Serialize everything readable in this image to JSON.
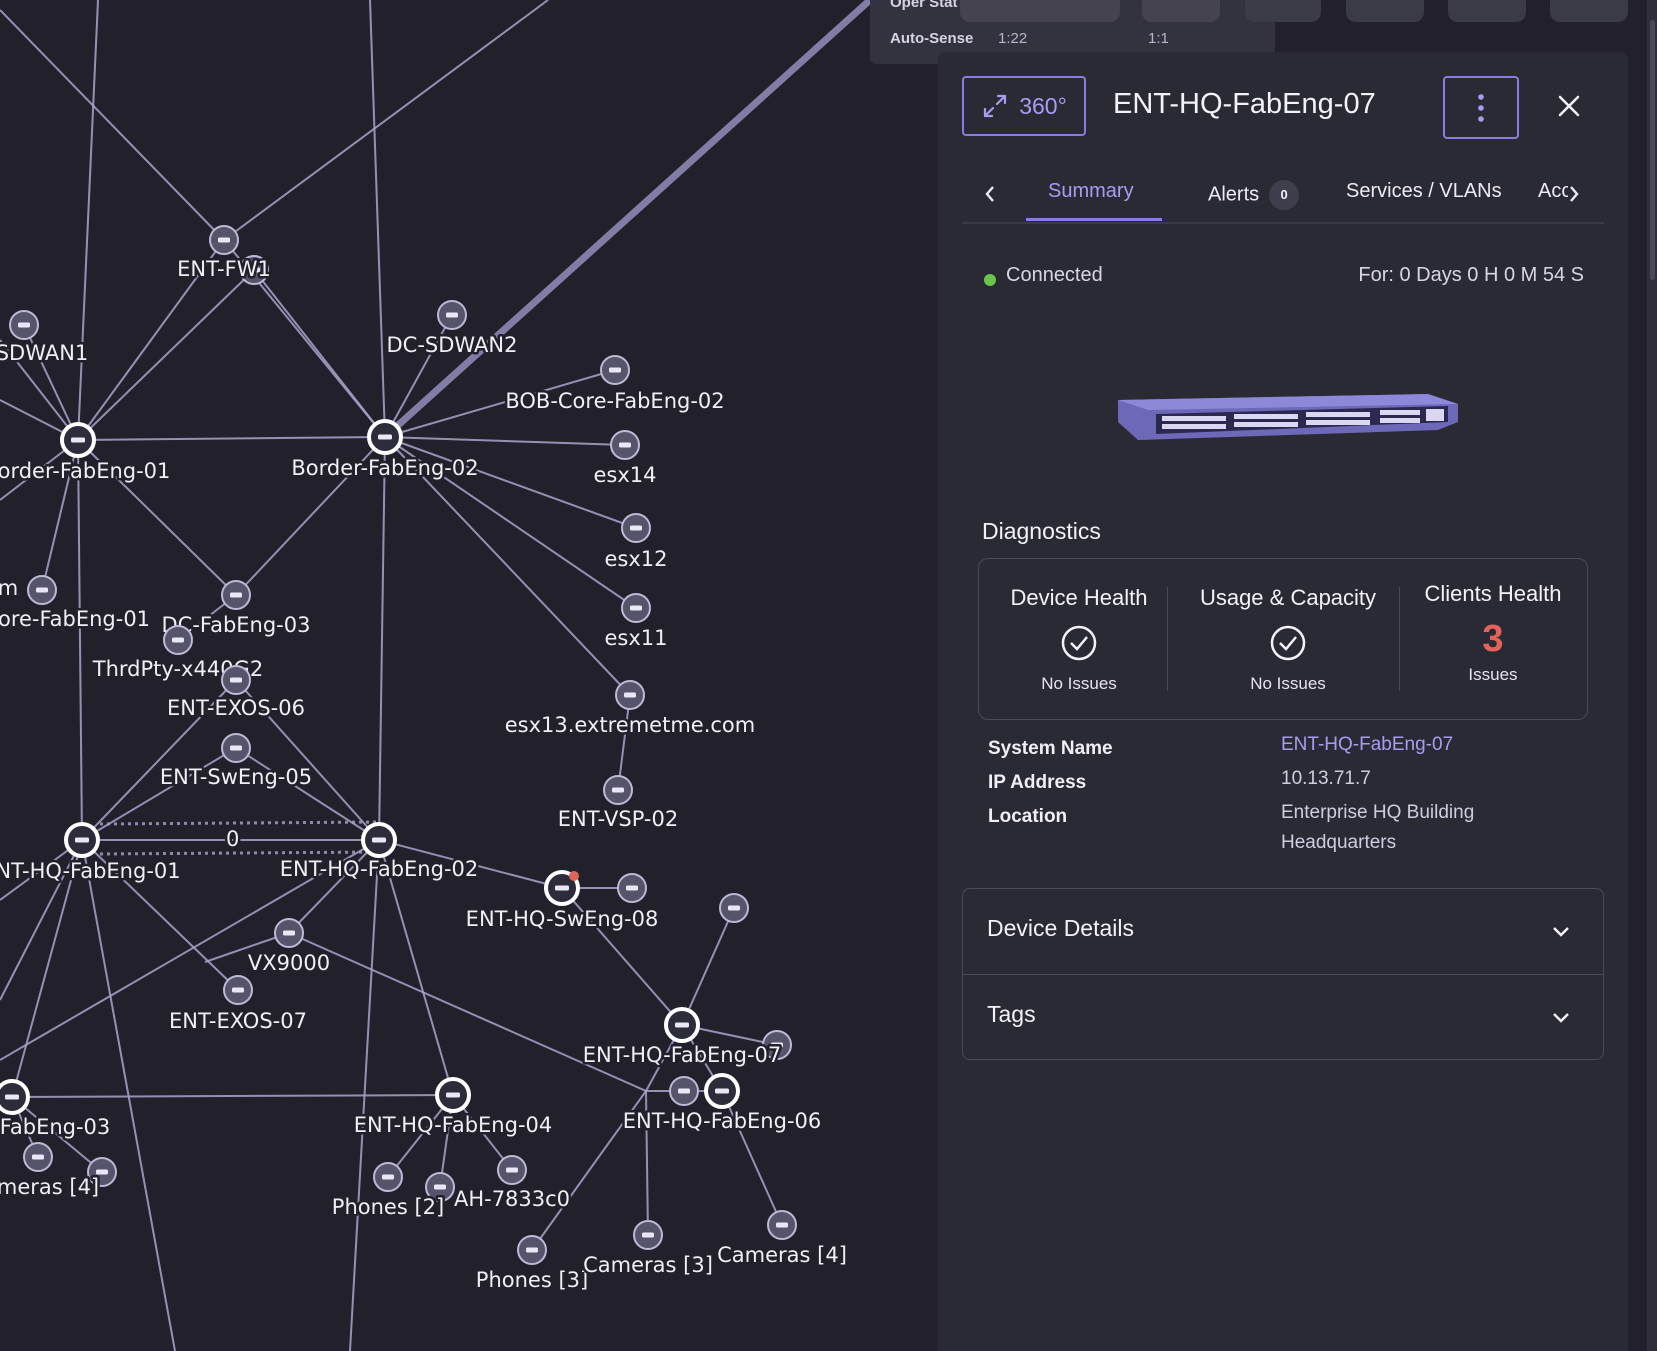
{
  "oper": {
    "oper_status_label": "Oper Stat",
    "auto_sense_label": "Auto-Sense",
    "val_a": "1:22",
    "val_b": "1:1"
  },
  "panel": {
    "view_360_label": "360°",
    "title": "ENT-HQ-FabEng-07",
    "tabs": [
      {
        "label": "Summary",
        "active": true
      },
      {
        "label": "Alerts",
        "badge": "0"
      },
      {
        "label": "Services / VLANs"
      },
      {
        "label": "Acc"
      }
    ],
    "status": "Connected",
    "uptime": "For: 0 Days 0 H 0 M 54 S",
    "diagnostics": {
      "title": "Diagnostics",
      "device_health": {
        "label": "Device Health",
        "value": "No Issues"
      },
      "usage_capacity": {
        "label": "Usage & Capacity",
        "value": "No Issues"
      },
      "clients_health": {
        "label": "Clients Health",
        "count": "3",
        "value": "Issues"
      }
    },
    "info": {
      "system_name_label": "System Name",
      "system_name": "ENT-HQ-FabEng-07",
      "ip_label": "IP Address",
      "ip": "10.13.71.7",
      "location_label": "Location",
      "location_line1": "Enterprise HQ Building",
      "location_line2": "Headquarters"
    },
    "sections": [
      {
        "title": "Device Details"
      },
      {
        "title": "Tags"
      }
    ]
  },
  "colors": {
    "accent": "#8a7be3",
    "connected": "#6cc24a",
    "issues": "#e3625a",
    "background": "#22212b"
  },
  "topology": {
    "nodes": [
      {
        "id": "fw1",
        "label": "ENT-FW1",
        "icon": "firewall-icon"
      },
      {
        "id": "sdwan1",
        "label": "SDWAN1",
        "icon": "router-icon"
      },
      {
        "id": "dcsdwan2",
        "label": "DC-SDWAN2",
        "icon": "router-icon"
      },
      {
        "id": "bobcore",
        "label": "BOB-Core-FabEng-02",
        "icon": "switch-icon"
      },
      {
        "id": "border01",
        "label": "order-FabEng-01",
        "icon": "switch-icon"
      },
      {
        "id": "border02",
        "label": "Border-FabEng-02",
        "icon": "switch-icon"
      },
      {
        "id": "esx14",
        "label": "esx14",
        "icon": "server-icon"
      },
      {
        "id": "esx12",
        "label": "esx12",
        "icon": "server-icon"
      },
      {
        "id": "esx11",
        "label": "esx11",
        "icon": "server-icon"
      },
      {
        "id": "esx13",
        "label": "esx13.extremetme.com",
        "icon": "server-icon"
      },
      {
        "id": "vsp02",
        "label": "ENT-VSP-02",
        "icon": "switch-icon"
      },
      {
        "id": "m",
        "label": "m",
        "icon": "switch-icon"
      },
      {
        "id": "corefab01",
        "label": "ore-FabEng-01",
        "icon": "switch-icon"
      },
      {
        "id": "dcfab03",
        "label": "DC-FabEng-03",
        "icon": "switch-icon"
      },
      {
        "id": "thrdpty",
        "label": "ThrdPty-x440G2",
        "icon": "switch-icon"
      },
      {
        "id": "exos06",
        "label": "ENT-EXOS-06",
        "icon": "switch-icon"
      },
      {
        "id": "sweng05",
        "label": "ENT-SwEng-05",
        "icon": "switch-icon"
      },
      {
        "id": "hqfab01",
        "label": "NT-HQ-FabEng-01",
        "icon": "switch-icon"
      },
      {
        "id": "hqfab02",
        "label": "ENT-HQ-FabEng-02",
        "icon": "switch-icon"
      },
      {
        "id": "sweng08",
        "label": "ENT-HQ-SwEng-08",
        "icon": "switch-icon"
      },
      {
        "id": "vx9000",
        "label": "VX9000",
        "icon": "controller-icon"
      },
      {
        "id": "exos07",
        "label": "ENT-EXOS-07",
        "icon": "switch-icon"
      },
      {
        "id": "hqfab07",
        "label": "ENT-HQ-FabEng-07",
        "icon": "switch-icon"
      },
      {
        "id": "hqfab04",
        "label": "ENT-HQ-FabEng-04",
        "icon": "switch-icon"
      },
      {
        "id": "hqfab06",
        "label": "ENT-HQ-FabEng-06",
        "icon": "switch-icon"
      },
      {
        "id": "fab03",
        "label": "FabEng-03",
        "icon": "switch-icon"
      },
      {
        "id": "cam4a",
        "label": "meras [4]",
        "icon": "camera-icon"
      },
      {
        "id": "phones2",
        "label": "Phones [2]",
        "icon": "phone-icon"
      },
      {
        "id": "ah7833",
        "label": "AH-7833c0",
        "icon": "access-point-icon"
      },
      {
        "id": "phones3",
        "label": "Phones [3]",
        "icon": "phone-icon"
      },
      {
        "id": "cam3",
        "label": "Cameras [3]",
        "icon": "camera-icon"
      },
      {
        "id": "cam4b",
        "label": "Cameras [4]",
        "icon": "camera-icon"
      }
    ],
    "dotted_link_label": "0"
  }
}
